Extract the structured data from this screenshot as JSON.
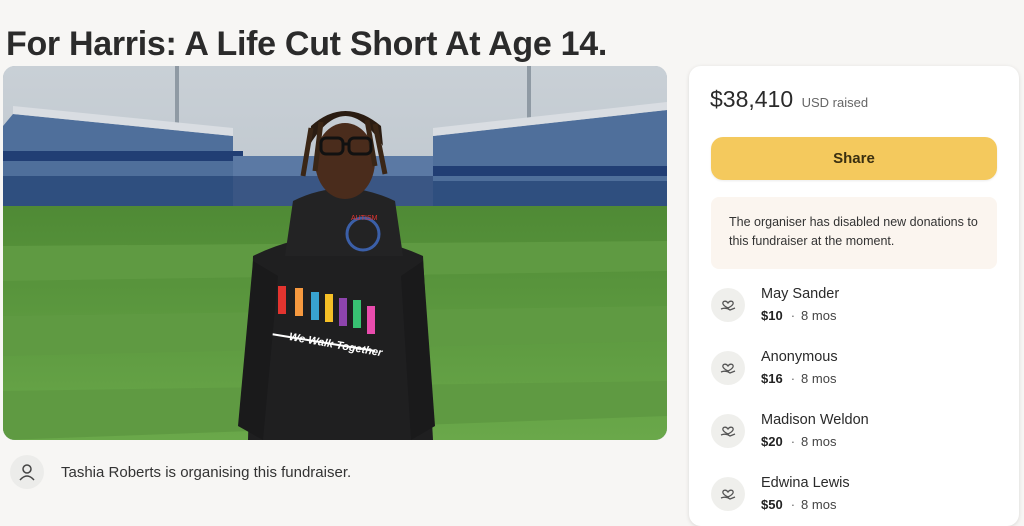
{
  "page": {
    "title": "For Harris: A Life Cut Short At Age 14."
  },
  "hero": {
    "shirt_logo_text": "AUTISM",
    "shirt_text": "We Walk Together"
  },
  "organiser": {
    "icon": "user-icon",
    "text": "Tashia Roberts is organising this fundraiser."
  },
  "donation_panel": {
    "raised_amount": "$38,410",
    "raised_label": "USD raised",
    "share_label": "Share",
    "notice": "The organiser has disabled new donations to this fundraiser at the moment.",
    "donors": [
      {
        "name": "May Sander",
        "amount": "$10",
        "time": "8 mos",
        "icon": "heart-hand-icon"
      },
      {
        "name": "Anonymous",
        "amount": "$16",
        "time": "8 mos",
        "icon": "heart-hand-icon"
      },
      {
        "name": "Madison Weldon",
        "amount": "$20",
        "time": "8 mos",
        "icon": "heart-hand-icon"
      },
      {
        "name": "Edwina Lewis",
        "amount": "$50",
        "time": "8 mos",
        "icon": "heart-hand-icon"
      }
    ]
  },
  "colors": {
    "share_button": "#f4c95d",
    "notice_bg": "#fbf5ef",
    "page_bg": "#f7f6f4"
  }
}
